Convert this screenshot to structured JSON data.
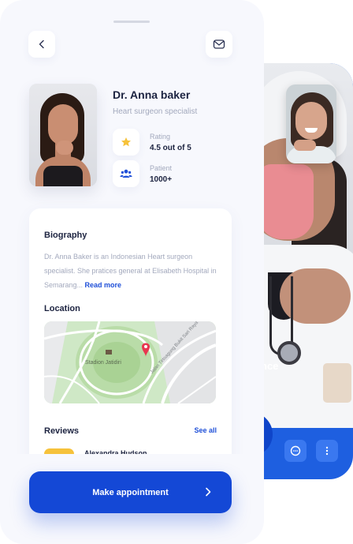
{
  "doctor": {
    "name": "Dr. Anna baker",
    "specialty": "Heart surgeon specialist",
    "photo_icon": "doctor-portrait"
  },
  "header": {
    "back_icon": "chevron-left-icon",
    "message_icon": "envelope-icon"
  },
  "stats": [
    {
      "label": "Rating",
      "value": "4.5 out of 5",
      "icon": "star-icon"
    },
    {
      "label": "Patient",
      "value": "1000+",
      "icon": "users-icon"
    }
  ],
  "biography": {
    "title": "Biography",
    "text": "Dr. Anna Baker is an Indonesian Heart surgeon specialist. She pratices general at Elisabeth Hospital in Semarang...",
    "read_more": "Read more"
  },
  "location": {
    "title": "Location",
    "map_label": "Stadion Jatidiri",
    "road_label": "Jalan Tirtoagung Bukit Sari Raya"
  },
  "reviews": {
    "title": "Reviews",
    "see_all": "See all",
    "first_reviewer": "Alexandra Hudson"
  },
  "cta": {
    "label": "Make appointment"
  },
  "video_call": {
    "caption_partial": "nce",
    "controls": [
      "end-call-button",
      "chat-icon",
      "more-vertical-icon"
    ]
  },
  "colors": {
    "primary": "#1448d6",
    "accent_star": "#f6c23b",
    "map_pin": "#e8364f",
    "map_green": "#b9dca8",
    "text_dark": "#1c2340",
    "text_muted": "#a3a9bd",
    "mask_pink": "#e98c92"
  }
}
